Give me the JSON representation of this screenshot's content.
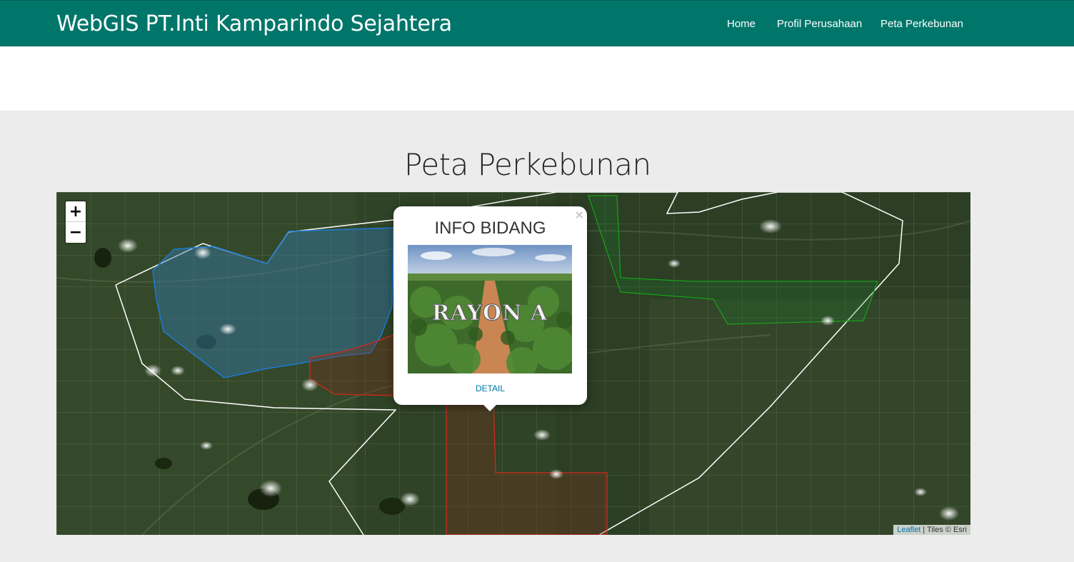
{
  "navbar": {
    "brand": "WebGIS PT.Inti Kamparindo Sejahtera",
    "items": [
      {
        "label": "Home"
      },
      {
        "label": "Profil Perusahaan"
      },
      {
        "label": "Peta Perkebunan"
      }
    ],
    "color": "#00766a"
  },
  "main": {
    "title": "Peta Perkebunan"
  },
  "map": {
    "zoom_in": "+",
    "zoom_out": "−",
    "attribution_link": "Leaflet",
    "attribution_text": " | Tiles © Esri",
    "layers": {
      "boundary_color": "#ffffff",
      "rayon_a_color": "#1e7bd6",
      "red_block_color": "#d0281e",
      "green_block_color": "#1aa11a"
    },
    "popup": {
      "close": "×",
      "title": "INFO BIDANG",
      "image_caption": "RAYON A",
      "link": "DETAIL"
    }
  }
}
